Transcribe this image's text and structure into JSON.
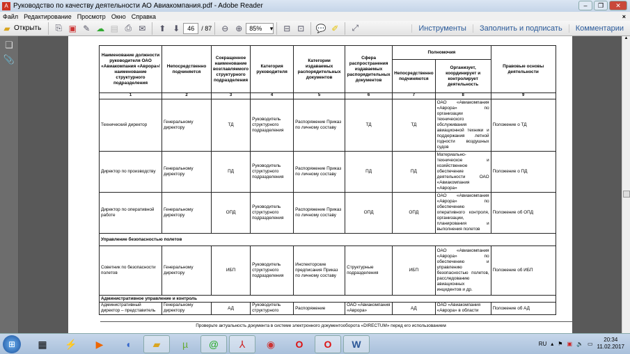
{
  "window": {
    "title": "Руководство по качеству деятельности АО Авиакомпания.pdf - Adobe Reader"
  },
  "menu": [
    "Файл",
    "Редактирование",
    "Просмотр",
    "Окно",
    "Справка"
  ],
  "toolbar": {
    "open": "Открыть",
    "page_current": "46",
    "page_total": "/ 87",
    "zoom": "85%",
    "tools": "Инструменты",
    "fill_sign": "Заполнить и подписать",
    "comments": "Комментарии"
  },
  "table": {
    "headers": {
      "h1": "Наименование должности руководителя ОАО «Авиакомпания «Аврора»/ наименование структурного подразделения",
      "h2": "Непосредственно подчиняется",
      "h3": "Сокращенное наименование возглавляемого структурного подразделения",
      "h4": "Категория руководителя",
      "h5": "Категории издаваемых распорядительных документов",
      "h6": "Сфера распространения издаваемых распорядительных документов",
      "h_powers": "Полномочия",
      "h7": "Непосредственно подчиняются",
      "h8": "Организует, координирует и контролирует деятельность",
      "h9": "Правовые основы деятельности"
    },
    "numbers": [
      "1",
      "2",
      "3",
      "4",
      "5",
      "6",
      "7",
      "8",
      "9"
    ],
    "rows": [
      [
        "Технический директор",
        "Генеральному директору",
        "ТД",
        "Руководитель структурного подразделения",
        "Распоряжение Приказ по личному составу",
        "ТД",
        "ТД",
        "ОАО «Авиакомпания «Аврора» по организации технического обслуживания авиационной техники и поддержания летной годности воздушных судов",
        "Положение о ТД"
      ],
      [
        "Директор по производству",
        "Генеральному директору",
        "ПД",
        "Руководитель структурного подразделения",
        "Распоряжение Приказ по личному составу",
        "ПД",
        "ПД",
        "Материально-техническое и хозяйственное обеспечение деятельности ОАО «Авиакомпания «Аврора»",
        "Положение о ПД"
      ],
      [
        "Директор по оперативной работе",
        "Генеральному директору",
        "ОПД",
        "Руководитель структурного подразделения",
        "Распоряжение Приказ по личному составу",
        "ОПД",
        "ОПД",
        "ОАО «Авиакомпания «Аврора» по обеспечению оперативного контроля, организации, планирования и выполнения полетов",
        "Положение об ОПД"
      ]
    ],
    "section1": "Управление безопасностью полетов",
    "row4": [
      "Советник по безопасности полетов",
      "Генеральному директору",
      "ИБП",
      "Руководитель структурного подразделения",
      "Инспекторские предписания Приказ по личному составу",
      "Структурные подразделения",
      "ИБП",
      "ОАО «Авиакомпания «Аврора» по обеспечению и управлению безопасностью полетов, расследованию авиационных инцидентов и др.",
      "Положение об ИБП"
    ],
    "section2": "Административное управление и контроль",
    "row5": [
      "Административный директор – представитель",
      "Генеральному директору",
      "АД",
      "Руководитель структурного",
      "Распоряжение",
      "ОАО «Авиакомпания «Аврора»",
      "АД",
      "ОАО «Авиакомпания «Аврора» в области",
      "Положение об АД"
    ]
  },
  "footer": "Проверьте актуальность документа в системе электронного документооборота «DIRECTUM» перед его использованием",
  "tray": {
    "lang": "RU",
    "time": "20:34",
    "date": "11.02.2017"
  }
}
